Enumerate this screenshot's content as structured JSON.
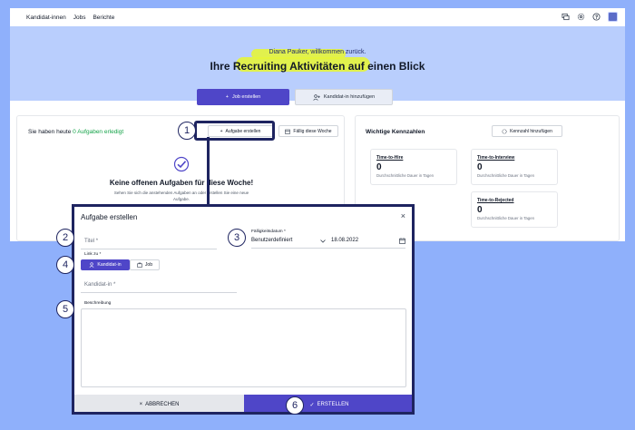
{
  "nav": {
    "items": [
      "Kandidat-innen",
      "Jobs",
      "Berichte"
    ]
  },
  "hero": {
    "greeting": "Diana Pauker, willkommen zurück.",
    "headline": "Ihre Recruiting Aktivitäten auf einen Blick",
    "primary_button": "Job erstellen",
    "secondary_button": "Kandidat-in hinzufügen"
  },
  "tasks": {
    "title_prefix": "Sie haben heute ",
    "title_highlight": "0 Aufgaben erledigt",
    "create_task_button": "Aufgabe erstellen",
    "due_week_button": "Fällig diese Woche",
    "empty_title": "Keine offenen Aufgaben für diese Woche!",
    "empty_sub": "Sehen Sie sich die anstehenden Aufgaben an oder erstellen Sie eine neue Aufgabe."
  },
  "kpis": {
    "title": "Wichtige Kennzahlen",
    "add_button": "Kennzahl hinzufügen",
    "items": [
      {
        "label": "Time-to-Hire",
        "value": "0",
        "desc": "Durchschnittliche Dauer in Tagen"
      },
      {
        "label": "Time-to-Interview",
        "value": "0",
        "desc": "Durchschnittliche Dauer in Tagen"
      },
      {
        "label": "Time-to-Rejected",
        "value": "0",
        "desc": "Durchschnittliche Dauer in Tagen"
      }
    ]
  },
  "modal": {
    "title": "Aufgabe erstellen",
    "close": "×",
    "title_placeholder": "Titel *",
    "due_label": "Fälligkeitsdatum *",
    "due_option": "Benutzerdefiniert",
    "due_date": "18.08.2022",
    "link_label": "Link zu *",
    "link_candidate": "Kandidat-in",
    "link_job": "Job",
    "candidate_placeholder": "Kandidat-in *",
    "description_label": "Beschreibung",
    "cancel": "ABBRECHEN",
    "create": "ERSTELLEN"
  },
  "badges": [
    "1",
    "2",
    "3",
    "4",
    "5",
    "6"
  ],
  "colors": {
    "background": "#8fb0fb",
    "hero": "#b9cefd",
    "primary": "#4f46c8",
    "highlight": "#e5f53a",
    "callout": "#1e2460"
  }
}
